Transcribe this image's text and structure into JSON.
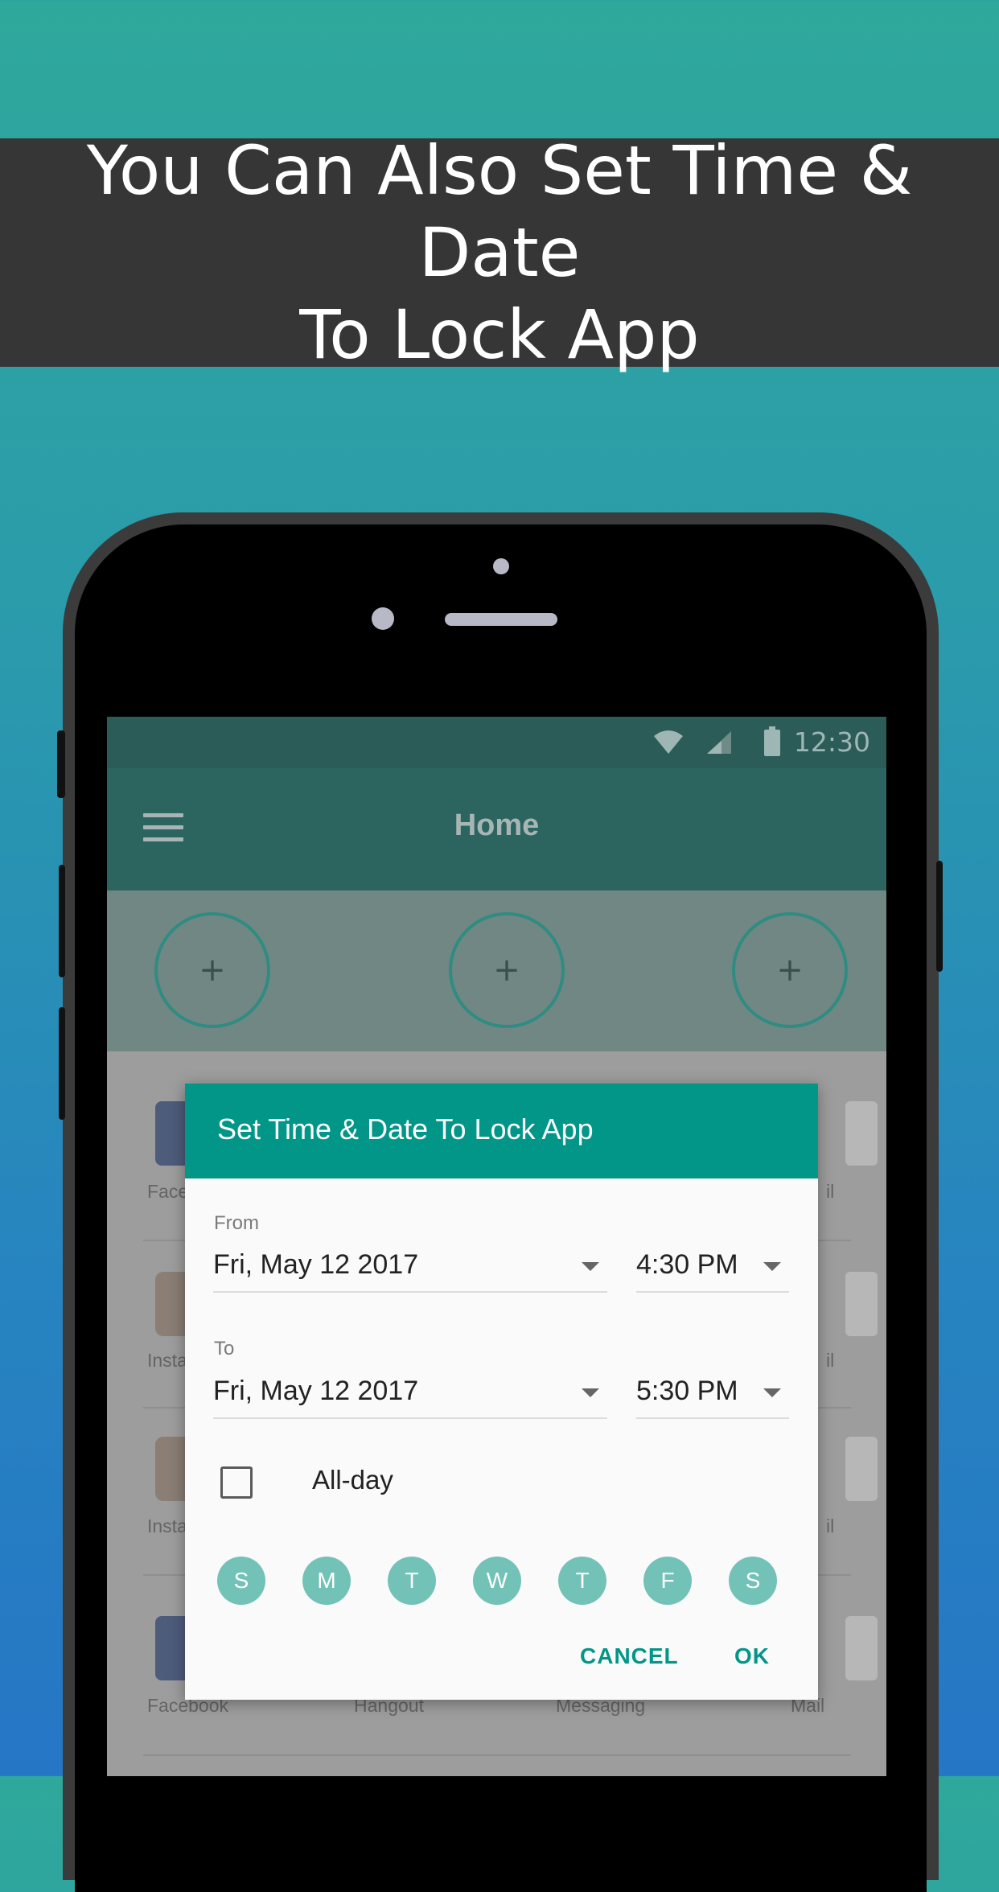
{
  "banner": {
    "line1": "You Can Also Set Time & Date",
    "line2": "To Lock App"
  },
  "status_bar": {
    "time": "12:30"
  },
  "app_bar": {
    "title": "Home"
  },
  "slots": [
    "+",
    "+",
    "+"
  ],
  "grid_labels": {
    "row1": [
      "Face",
      "il"
    ],
    "row2": [
      "Insta",
      "il"
    ],
    "row3": [
      "Insta",
      "il"
    ],
    "row4": [
      "Facebook",
      "Hangout",
      "Messaging",
      "Mail"
    ]
  },
  "dialog": {
    "title": "Set Time & Date To Lock App",
    "from_label": "From",
    "from_date": "Fri, May 12 2017",
    "from_time": "4:30 PM",
    "to_label": "To",
    "to_date": "Fri, May 12 2017",
    "to_time": "5:30 PM",
    "allday_label": "All-day",
    "allday_checked": false,
    "days": [
      "S",
      "M",
      "T",
      "W",
      "T",
      "F",
      "S"
    ],
    "cancel_label": "CANCEL",
    "ok_label": "OK"
  },
  "colors": {
    "accent": "#029688",
    "banner_bg": "#373637",
    "day_chip": "#73c2b7"
  }
}
